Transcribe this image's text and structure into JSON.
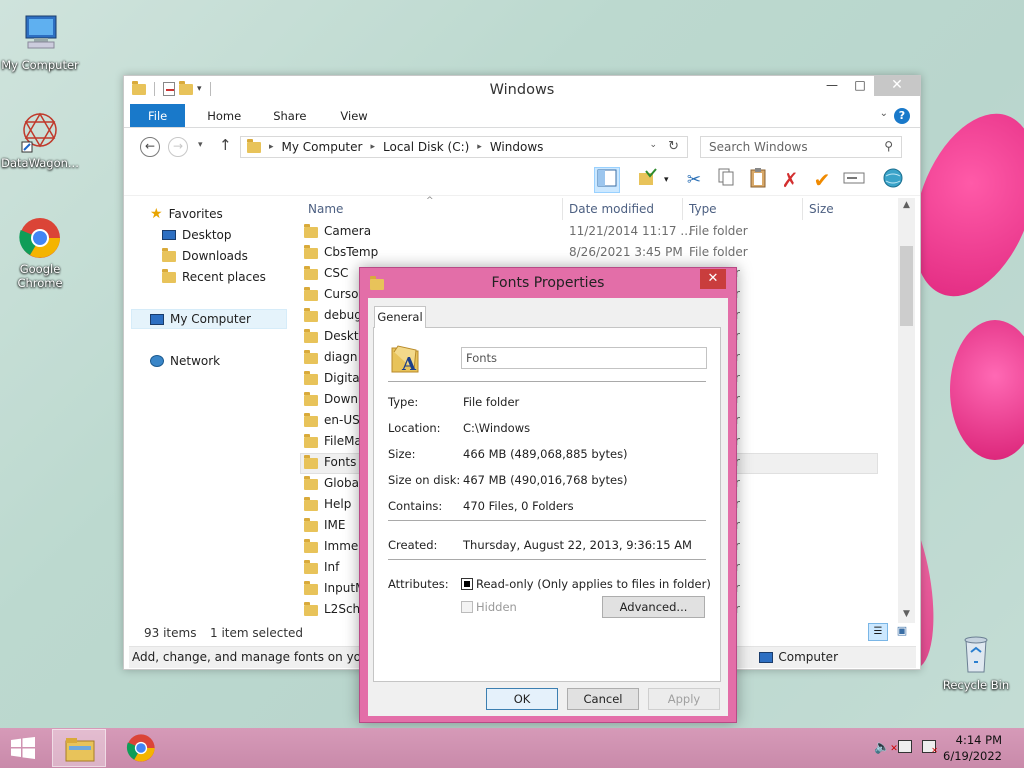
{
  "desktop": {
    "icons": [
      {
        "label": "My Computer"
      },
      {
        "label": "DataWagon..."
      },
      {
        "label": "Google Chrome"
      },
      {
        "label": "Recycle Bin"
      }
    ]
  },
  "explorer": {
    "title": "Windows",
    "tabs": [
      "File",
      "Home",
      "Share",
      "View"
    ],
    "help_label": "?",
    "breadcrumb": [
      "My Computer",
      "Local Disk (C:)",
      "Windows"
    ],
    "search_placeholder": "Search Windows",
    "nav": {
      "favorites": "Favorites",
      "desktop": "Desktop",
      "downloads": "Downloads",
      "recent": "Recent places",
      "computer": "My Computer",
      "network": "Network"
    },
    "columns": {
      "name": "Name",
      "date": "Date modified",
      "type": "Type",
      "size": "Size"
    },
    "rows": [
      {
        "name": "Camera",
        "date": "11/21/2014 11:17 ...",
        "type": "File folder"
      },
      {
        "name": "CbsTemp",
        "date": "8/26/2021 3:45 PM",
        "type": "File folder"
      },
      {
        "name": "CSC",
        "type": "r"
      },
      {
        "name": "Curso",
        "type": "r"
      },
      {
        "name": "debug",
        "type": "r"
      },
      {
        "name": "Deskto",
        "type": "r"
      },
      {
        "name": "diagn",
        "type": "r"
      },
      {
        "name": "Digita",
        "type": "r"
      },
      {
        "name": "Down",
        "type": "r"
      },
      {
        "name": "en-US",
        "type": "r"
      },
      {
        "name": "FileMa",
        "type": "r"
      },
      {
        "name": "Fonts",
        "type": "r"
      },
      {
        "name": "Globa",
        "type": "r"
      },
      {
        "name": "Help",
        "type": "r"
      },
      {
        "name": "IME",
        "type": "r"
      },
      {
        "name": "Imme",
        "type": "r"
      },
      {
        "name": "Inf",
        "type": "r"
      },
      {
        "name": "InputM",
        "type": "r"
      },
      {
        "name": "L2Sch",
        "type": "r"
      }
    ],
    "status": {
      "count": "93 items",
      "selected": "1 item selected",
      "tip": "Add, change, and manage fonts on your co",
      "location": "Computer"
    }
  },
  "dialog": {
    "title": "Fonts Properties",
    "tab": "General",
    "name_value": "Fonts",
    "type_label": "Type:",
    "type_value": "File folder",
    "location_label": "Location:",
    "location_value": "C:\\Windows",
    "size_label": "Size:",
    "size_value": "466 MB (489,068,885 bytes)",
    "size_disk_label": "Size on disk:",
    "size_disk_value": "467 MB (490,016,768 bytes)",
    "contains_label": "Contains:",
    "contains_value": "470 Files, 0 Folders",
    "created_label": "Created:",
    "created_value": "Thursday, August 22, 2013, 9:36:15 AM",
    "attributes_label": "Attributes:",
    "readonly_label": "Read-only (Only applies to files in folder)",
    "hidden_label": "Hidden",
    "advanced_label": "Advanced...",
    "ok_label": "OK",
    "cancel_label": "Cancel",
    "apply_label": "Apply"
  },
  "taskbar": {
    "time": "4:14 PM",
    "date": "6/19/2022"
  },
  "colors": {
    "accent": "#1979ca",
    "dialog_frame": "#e36ea8",
    "taskbar": "#d69ab8"
  }
}
